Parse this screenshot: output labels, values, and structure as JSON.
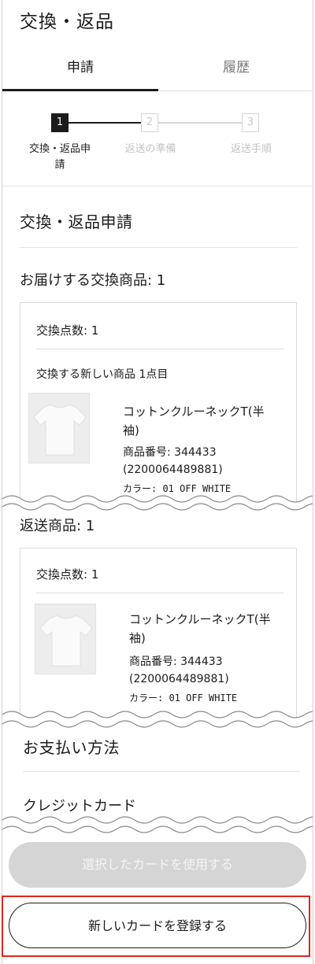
{
  "page": {
    "title": "交換・返品"
  },
  "tabs": [
    {
      "label": "申請"
    },
    {
      "label": "履歴"
    }
  ],
  "steps": [
    {
      "number": "1",
      "label_line1": "交換・返品申",
      "label_line2": "請"
    },
    {
      "number": "2",
      "label_line1": "返送の準備"
    },
    {
      "number": "3",
      "label_line1": "返送手順"
    }
  ],
  "request": {
    "heading": "交換・返品申請",
    "exchange_items_title": "お届けする交換商品: 1",
    "exchange_card": {
      "count_label": "交換点数: 1",
      "new_item_label": "交換する新しい商品 1点目",
      "product_name_line1": "コットンクルーネックT(半",
      "product_name_line2": "袖)",
      "product_number": "商品番号: 344433",
      "jan": "(2200064489881)",
      "color": "カラー: 01 OFF WHITE"
    },
    "return_items_title": "返送商品: 1",
    "return_card": {
      "count_label": "交換点数: 1",
      "product_name_line1": "コットンクルーネックT(半",
      "product_name_line2": "袖)",
      "product_number": "商品番号: 344433",
      "jan": "(2200064489881)",
      "color": "カラー: 01 OFF WHITE"
    }
  },
  "payment": {
    "heading": "お支払い方法",
    "method": "クレジットカード"
  },
  "buttons": {
    "use_selected_card": "選択したカードを使用する",
    "register_new_card": "新しいカードを登録する"
  },
  "colors": {
    "text": "#1b1b1b",
    "muted": "#c3c3c3",
    "disabled_button": "#d5d5d5",
    "highlight": "#e0261b"
  }
}
